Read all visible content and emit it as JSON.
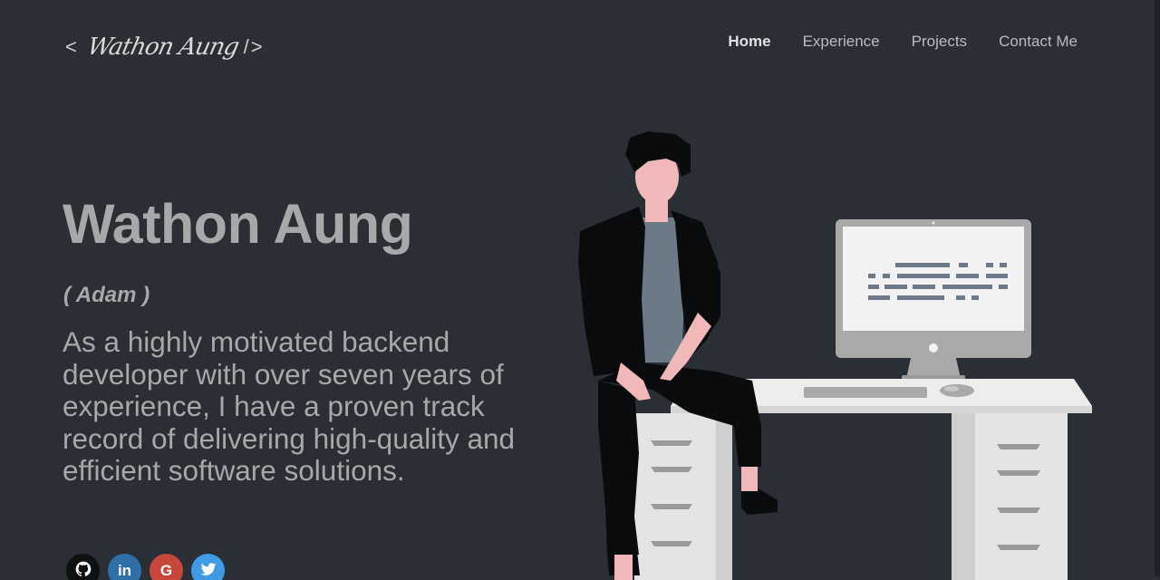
{
  "logo": {
    "open": "<",
    "name": "Wathon Aung",
    "close": "/>"
  },
  "nav": {
    "items": [
      {
        "label": "Home",
        "active": true
      },
      {
        "label": "Experience",
        "active": false
      },
      {
        "label": "Projects",
        "active": false
      },
      {
        "label": "Contact Me",
        "active": false
      }
    ]
  },
  "hero": {
    "name": "Wathon Aung",
    "nickname": "( Adam )",
    "bio": "As a highly motivated backend developer with over seven years of experience, I have a proven track record of delivering high-quality and efficient software solutions."
  },
  "socials": [
    {
      "icon": "github-icon",
      "glyph": "",
      "color": "#0f1011"
    },
    {
      "icon": "linkedin-icon",
      "glyph": "in",
      "color": "#2f6fa7"
    },
    {
      "icon": "google-icon",
      "glyph": "G",
      "color": "#c8473c"
    },
    {
      "icon": "twitter-icon",
      "glyph": "",
      "color": "#3f9be3"
    }
  ],
  "colors": {
    "background": "#2a2f35",
    "text": "#a7a8a9",
    "nav_active": "#e0e3e6",
    "nav_inactive": "#b9bdc2"
  },
  "illustration": {
    "icon": "developer-at-desk-illustration"
  }
}
